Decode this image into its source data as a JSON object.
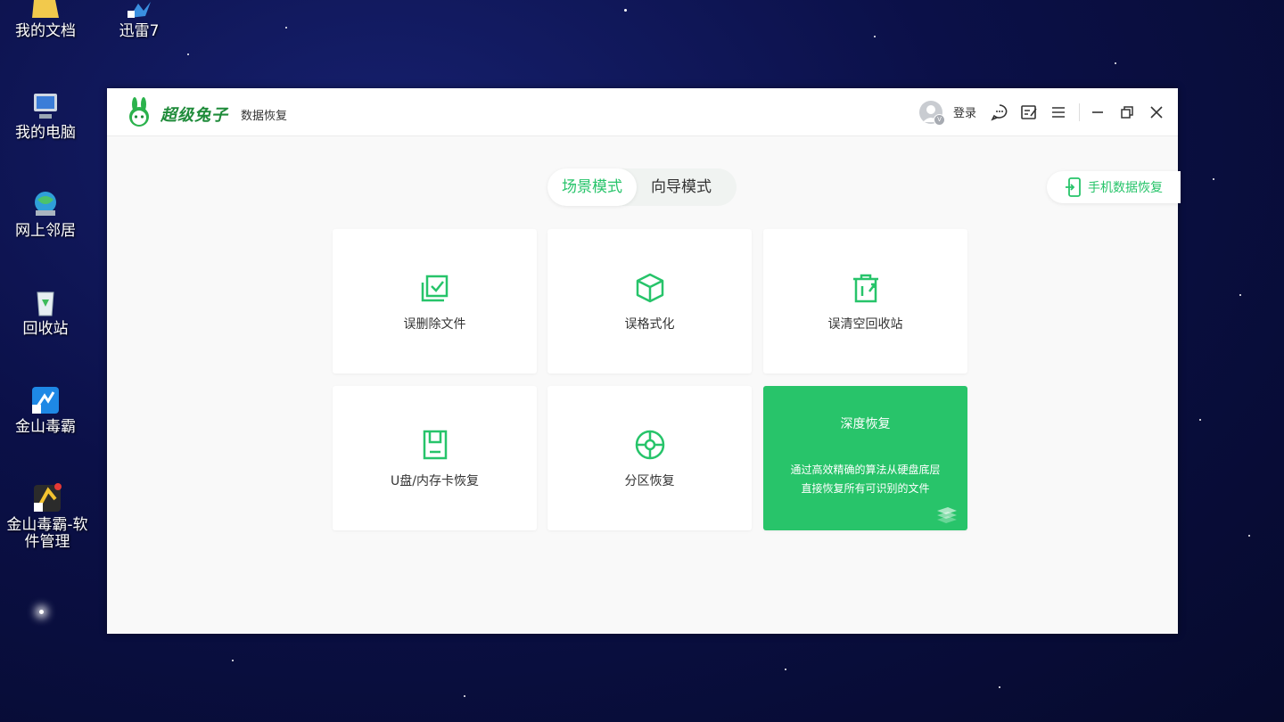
{
  "desktop": {
    "icons": [
      {
        "label": "我的文档"
      },
      {
        "label": "迅雷7"
      },
      {
        "label": "我的电脑"
      },
      {
        "label": "网上邻居"
      },
      {
        "label": "回收站"
      },
      {
        "label": "金山毒霸"
      },
      {
        "label": "金山毒霸-软件管理"
      }
    ]
  },
  "app": {
    "brand": "超级兔子",
    "brand_sub": "数据恢复",
    "login": "登录",
    "avatar_badge": "V",
    "modes": [
      "场景模式",
      "向导模式"
    ],
    "active_mode": "场景模式",
    "phone_recovery": "手机数据恢复",
    "cards": [
      {
        "title": "误删除文件",
        "icon": "recycle-file-icon"
      },
      {
        "title": "误格式化",
        "icon": "box-icon"
      },
      {
        "title": "误清空回收站",
        "icon": "trash-icon"
      },
      {
        "title": "U盘/内存卡恢复",
        "icon": "sdcard-icon"
      },
      {
        "title": "分区恢复",
        "icon": "partition-icon"
      }
    ],
    "deep": {
      "title": "深度恢复",
      "desc_line1": "通过高效精确的算法从硬盘底层",
      "desc_line2": "直接恢复所有可识别的文件"
    },
    "colors": {
      "accent": "#27c46a",
      "brand_text": "#1f8b3a",
      "window_bg": "#f9f9f9"
    }
  }
}
